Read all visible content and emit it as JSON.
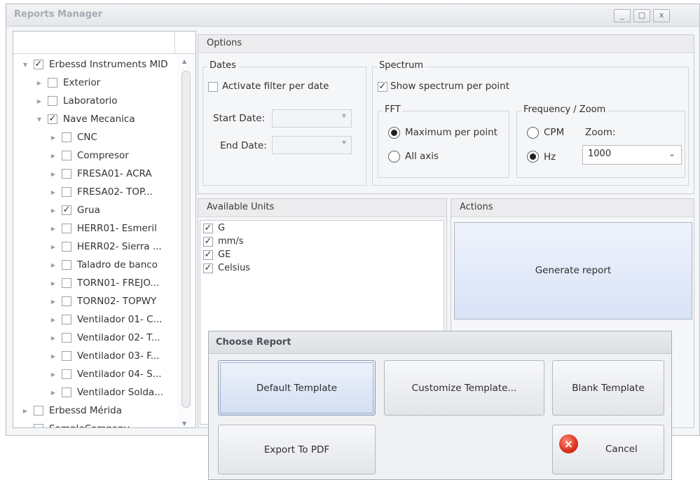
{
  "window": {
    "title": "Reports Manager",
    "controls": {
      "minimize": "_",
      "maximize": "□",
      "close": "x"
    }
  },
  "tree": {
    "items": [
      {
        "label": "Erbessd Instruments MID",
        "checked": true,
        "expanded": true
      },
      {
        "label": "Exterior",
        "checked": false
      },
      {
        "label": "Laboratorio",
        "checked": false
      },
      {
        "label": "Nave Mecanica",
        "checked": true,
        "expanded": true
      },
      {
        "label": "CNC",
        "checked": false
      },
      {
        "label": "Compresor",
        "checked": false
      },
      {
        "label": "FRESA01- ACRA",
        "checked": false
      },
      {
        "label": "FRESA02- TOP...",
        "checked": false
      },
      {
        "label": "Grua",
        "checked": true
      },
      {
        "label": "HERR01- Esmeril",
        "checked": false
      },
      {
        "label": "HERR02- Sierra ...",
        "checked": false
      },
      {
        "label": "Taladro de banco",
        "checked": false
      },
      {
        "label": "TORN01- FREJO...",
        "checked": false
      },
      {
        "label": "TORN02- TOPWY",
        "checked": false
      },
      {
        "label": "Ventilador 01- C...",
        "checked": false
      },
      {
        "label": "Ventilador 02- T...",
        "checked": false
      },
      {
        "label": "Ventilador 03- F...",
        "checked": false
      },
      {
        "label": "Ventilador 04- S...",
        "checked": false
      },
      {
        "label": "Ventilador Solda...",
        "checked": false
      },
      {
        "label": "Erbessd Mérida",
        "checked": false
      },
      {
        "label": "SampleCompany",
        "checked": false
      }
    ]
  },
  "options": {
    "title": "Options",
    "dates": {
      "title": "Dates",
      "activate_filter": "Activate filter per date",
      "activate_checked": false,
      "start_label": "Start Date:",
      "end_label": "End Date:"
    },
    "spectrum": {
      "title": "Spectrum",
      "show_spectrum": "Show spectrum per point",
      "show_checked": true,
      "fft": {
        "title": "FFT",
        "maximum": "Maximum per point",
        "all_axis": "All axis",
        "selected": "maximum"
      },
      "freq": {
        "title": "Frequency / Zoom",
        "cpm": "CPM",
        "hz": "Hz",
        "selected": "hz",
        "zoom_label": "Zoom:",
        "zoom_value": "1000"
      }
    }
  },
  "units": {
    "title": "Available Units",
    "items": [
      {
        "label": "G",
        "checked": true
      },
      {
        "label": "mm/s",
        "checked": true
      },
      {
        "label": "GE",
        "checked": true
      },
      {
        "label": "Celsius",
        "checked": true
      }
    ]
  },
  "actions": {
    "title": "Actions",
    "generate": "Generate report"
  },
  "dialog": {
    "title": "Choose Report",
    "default_template": "Default Template",
    "customize_template": "Customize Template...",
    "blank_template": "Blank Template",
    "export_pdf": "Export To PDF",
    "cancel": "Cancel"
  },
  "icons": {
    "tree_expanded": "▼",
    "tree_collapsed": "▶",
    "check": "✓",
    "cancel": "×"
  }
}
